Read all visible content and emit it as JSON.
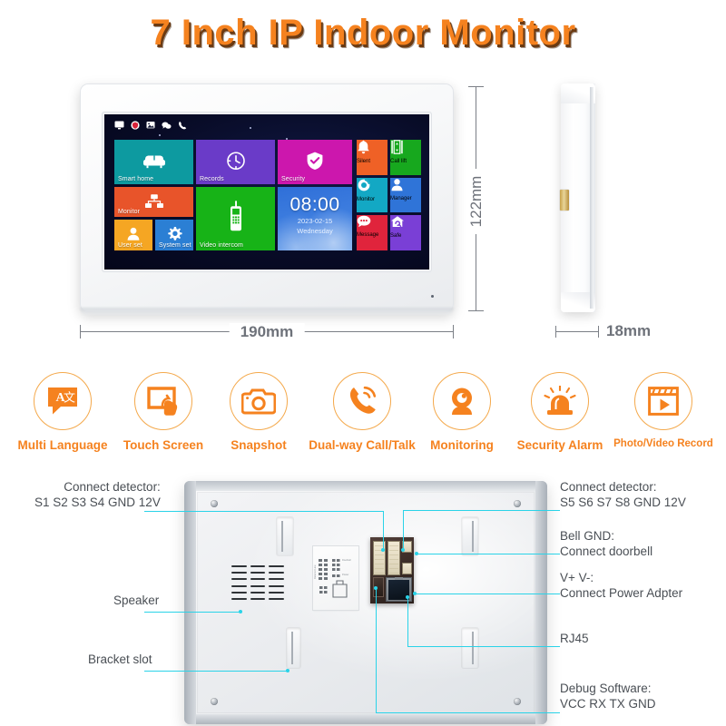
{
  "title": "7 Inch IP Indoor Monitor",
  "device_front": {
    "statusbar_icons": [
      "monitor-icon",
      "shield-icon",
      "image-icon",
      "chat-icon",
      "phone-icon"
    ],
    "tiles": [
      {
        "id": "smart-home",
        "label": "Smart home",
        "color": "#0d9aa0",
        "icon": "sofa-icon"
      },
      {
        "id": "records",
        "label": "Records",
        "color": "#6a3bc8",
        "icon": "clock-icon"
      },
      {
        "id": "security",
        "label": "Security",
        "color": "#cc17ad",
        "icon": "shield-check-icon"
      },
      {
        "id": "monitor",
        "label": "Monitor",
        "color": "#e8542a",
        "icon": "network-icon"
      },
      {
        "id": "user-set",
        "label": "User set",
        "color": "#f5a623",
        "icon": "user-icon"
      },
      {
        "id": "system-set",
        "label": "System set",
        "color": "#2b7fd4",
        "icon": "gear-icon"
      },
      {
        "id": "video-intercom",
        "label": "Video intercom",
        "color": "#17b317",
        "icon": "handset-icon"
      }
    ],
    "side_tiles": [
      {
        "id": "silent",
        "label": "Silent",
        "color": "#ef6126",
        "icon": "bell-icon"
      },
      {
        "id": "call-lift",
        "label": "Call lift",
        "color": "#17a81e",
        "icon": "elevator-icon"
      },
      {
        "id": "monitor2",
        "label": "Monitor",
        "color": "#13a8c4",
        "icon": "camera-eye-icon"
      },
      {
        "id": "manager",
        "label": "Manager",
        "color": "#2f74d8",
        "icon": "person-icon"
      },
      {
        "id": "message",
        "label": "Message",
        "color": "#e0243c",
        "icon": "message-icon"
      },
      {
        "id": "safe",
        "label": "Safe",
        "color": "#7a3fd6",
        "icon": "safe-house-icon"
      }
    ],
    "clock": {
      "time": "08:00",
      "date": "2023-02-15",
      "weekday": "Wednesday"
    }
  },
  "dimensions": {
    "height": "122mm",
    "width": "190mm",
    "depth": "18mm"
  },
  "features": [
    {
      "id": "multi-language",
      "label": "Multi Language",
      "icon": "translate-icon"
    },
    {
      "id": "touch-screen",
      "label": "Touch Screen",
      "icon": "touch-icon"
    },
    {
      "id": "snapshot",
      "label": "Snapshot",
      "icon": "camera-icon"
    },
    {
      "id": "dual-way-call",
      "label": "Dual-way Call/Talk",
      "icon": "phone-call-icon"
    },
    {
      "id": "monitoring",
      "label": "Monitoring",
      "icon": "webcam-icon"
    },
    {
      "id": "security-alarm",
      "label": "Security Alarm",
      "icon": "siren-icon"
    },
    {
      "id": "photo-video-record",
      "label": "Photo/Video Record",
      "icon": "video-play-icon"
    }
  ],
  "callouts": {
    "left": [
      {
        "id": "connect-detector-s1",
        "lines": [
          "Connect detector:",
          "S1 S2 S3 S4 GND 12V"
        ]
      },
      {
        "id": "speaker",
        "lines": [
          "Speaker"
        ]
      },
      {
        "id": "bracket-slot",
        "lines": [
          "Bracket slot"
        ]
      }
    ],
    "right": [
      {
        "id": "connect-detector-s5",
        "lines": [
          "Connect detector:",
          "S5 S6 S7 S8 GND 12V"
        ]
      },
      {
        "id": "bell-gnd",
        "lines": [
          "Bell GND:",
          "Connect doorbell"
        ]
      },
      {
        "id": "power-adapter",
        "lines": [
          "V+ V-:",
          "Connect Power Adpter"
        ]
      },
      {
        "id": "rj45",
        "lines": [
          "RJ45"
        ]
      },
      {
        "id": "debug-software",
        "lines": [
          "Debug Software:",
          "VCC RX TX GND"
        ]
      }
    ]
  },
  "colors": {
    "brand_orange": "#F5821F",
    "callout_cyan": "#2ad3e8",
    "dimension_gray": "#6e727a"
  }
}
